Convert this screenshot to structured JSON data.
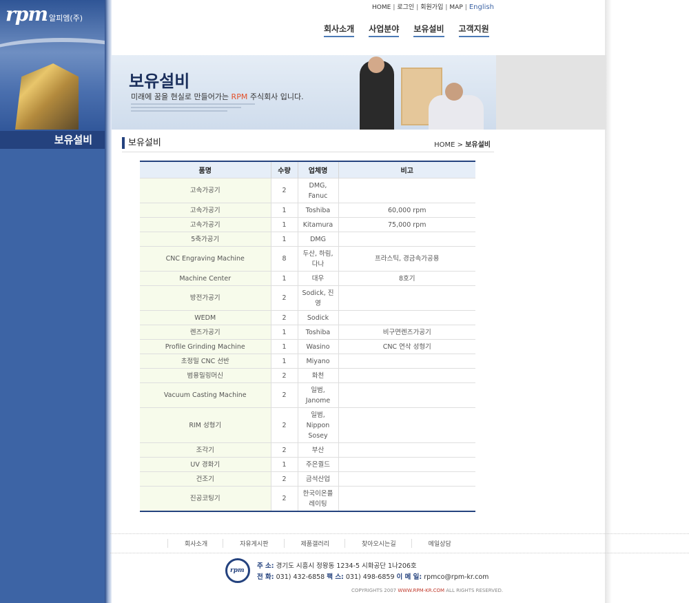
{
  "logo": {
    "brand": "rpm",
    "sub": "알피엠(주)"
  },
  "sidebar": {
    "title": "보유설비"
  },
  "topnav": {
    "home": "HOME",
    "login": "로그인",
    "join": "회원가입",
    "map": "MAP",
    "english": "English"
  },
  "mainnav": {
    "company": "회사소개",
    "business": "사업분야",
    "equipment": "보유설비",
    "support": "고객지원"
  },
  "banner": {
    "title": "보유설비",
    "subtitle_pre": "미래에 꿈을 현실로 만들어가는 ",
    "subtitle_rpm": "RPM",
    "subtitle_post": " 주식회사 입니다."
  },
  "section": {
    "title": "보유설비"
  },
  "breadcrumb": {
    "home": "HOME",
    "arrow": ">",
    "current": "보유설비"
  },
  "table": {
    "headers": [
      "품명",
      "수량",
      "업체명",
      "비고"
    ],
    "rows": [
      {
        "name": "고속가공기",
        "qty": "2",
        "maker": "DMG, Fanuc",
        "note": "",
        "cls": "h2"
      },
      {
        "name": "고속가공기",
        "qty": "1",
        "maker": "Toshiba",
        "note": "60,000 rpm",
        "cls": "h1"
      },
      {
        "name": "고속가공기",
        "qty": "1",
        "maker": "Kitamura",
        "note": "75,000 rpm",
        "cls": "h1"
      },
      {
        "name": "5축가공기",
        "qty": "1",
        "maker": "DMG",
        "note": "",
        "cls": "h1"
      },
      {
        "name": "CNC Engraving Machine",
        "qty": "8",
        "maker": "두산, 하림, 다나",
        "note": "프라스틱, 경금속가공용",
        "cls": "h2"
      },
      {
        "name": "Machine Center",
        "qty": "1",
        "maker": "대우",
        "note": "8호기",
        "cls": "h1"
      },
      {
        "name": "방전가공기",
        "qty": "2",
        "maker": "Sodick, 진영",
        "note": "",
        "cls": "h2"
      },
      {
        "name": "WEDM",
        "qty": "2",
        "maker": "Sodick",
        "note": "",
        "cls": "h1"
      },
      {
        "name": "렌즈가공기",
        "qty": "1",
        "maker": "Toshiba",
        "note": "비구면렌즈가공기",
        "cls": "h1"
      },
      {
        "name": "Profile Grinding Machine",
        "qty": "1",
        "maker": "Wasino",
        "note": "CNC 연삭 성형기",
        "cls": "h1"
      },
      {
        "name": "초정밀 CNC 선반",
        "qty": "1",
        "maker": "Miyano",
        "note": "",
        "cls": "h1"
      },
      {
        "name": "범용밀링머신",
        "qty": "2",
        "maker": "화천",
        "note": "",
        "cls": "h1"
      },
      {
        "name": "Vacuum Casting Machine",
        "qty": "2",
        "maker": "일범, Janome",
        "note": "",
        "cls": "h2"
      },
      {
        "name": "RIM 성형기",
        "qty": "2",
        "maker": "일범, Nippon Sosey",
        "note": "",
        "cls": "h3"
      },
      {
        "name": "조각기",
        "qty": "2",
        "maker": "부산",
        "note": "",
        "cls": "h1"
      },
      {
        "name": "UV 경화기",
        "qty": "1",
        "maker": "주은퀼드",
        "note": "",
        "cls": "h1"
      },
      {
        "name": "건조기",
        "qty": "2",
        "maker": "금석산업",
        "note": "",
        "cls": "h1"
      },
      {
        "name": "진공코팅기",
        "qty": "2",
        "maker": "한국이온플레이팅",
        "note": "",
        "cls": "h2"
      }
    ]
  },
  "footer": {
    "links": [
      "회사소개",
      "자유게시판",
      "제품갤러리",
      "찾아오시는길",
      "메일상담"
    ],
    "logo_text": "rpm",
    "address_label": "주    소:",
    "address": "경기도 시흥시 정왕동 1234-5 시화공단 1나206호",
    "tel_label": "전    화:",
    "tel": "031) 432-6858",
    "fax_label": "팩    스:",
    "fax": "031) 498-6859",
    "email_label": "이 메 일:",
    "email": "rpmco@rpm-kr.com",
    "copyright_pre": "COPYRIGHTS 2007 ",
    "copyright_url": "WWW.RPM-KR.COM",
    "copyright_post": " ALL RIGHTS RESERVED."
  }
}
